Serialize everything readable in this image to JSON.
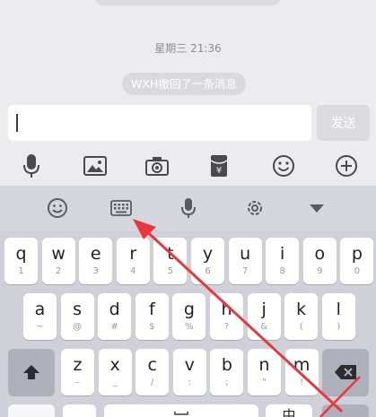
{
  "chat": {
    "timestamp": "星期三 21:36",
    "recall_notice": "WXH撤回了一条消息"
  },
  "input": {
    "value": "",
    "placeholder": ""
  },
  "send_button": {
    "label": "发送"
  },
  "toolbar_icons": [
    "microphone-icon",
    "image-icon",
    "camera-icon",
    "red-packet-icon",
    "emoji-icon",
    "plus-icon"
  ],
  "keyboard": {
    "toolbar_icons": [
      "emoji-icon",
      "keyboard-icon",
      "microphone-icon",
      "gear-icon",
      "collapse-icon"
    ],
    "row1": [
      {
        "letter": "q",
        "sub": "1"
      },
      {
        "letter": "w",
        "sub": "2"
      },
      {
        "letter": "e",
        "sub": "3"
      },
      {
        "letter": "r",
        "sub": "4"
      },
      {
        "letter": "t",
        "sub": "5"
      },
      {
        "letter": "y",
        "sub": "6"
      },
      {
        "letter": "u",
        "sub": "7"
      },
      {
        "letter": "i",
        "sub": "8"
      },
      {
        "letter": "o",
        "sub": "9"
      },
      {
        "letter": "p",
        "sub": "0"
      }
    ],
    "row2": [
      {
        "letter": "a",
        "sub": "~"
      },
      {
        "letter": "s",
        "sub": "@"
      },
      {
        "letter": "d",
        "sub": "#"
      },
      {
        "letter": "f",
        "sub": "$"
      },
      {
        "letter": "g",
        "sub": "%"
      },
      {
        "letter": "h",
        "sub": "?"
      },
      {
        "letter": "j",
        "sub": "&"
      },
      {
        "letter": "k",
        "sub": "("
      },
      {
        "letter": "l",
        "sub": ")"
      }
    ],
    "row3": [
      {
        "letter": "z",
        "sub": "–"
      },
      {
        "letter": "x",
        "sub": "_"
      },
      {
        "letter": "c",
        "sub": "/"
      },
      {
        "letter": "v",
        "sub": ":"
      },
      {
        "letter": "b",
        "sub": ";"
      },
      {
        "letter": "n",
        "sub": "\""
      },
      {
        "letter": "m",
        "sub": "!"
      }
    ],
    "row4_partial": "中"
  },
  "colors": {
    "accent_arrow": "#e8383d",
    "icon_gray": "#4a4a4e",
    "send_disabled_bg": "#dcdce0"
  }
}
